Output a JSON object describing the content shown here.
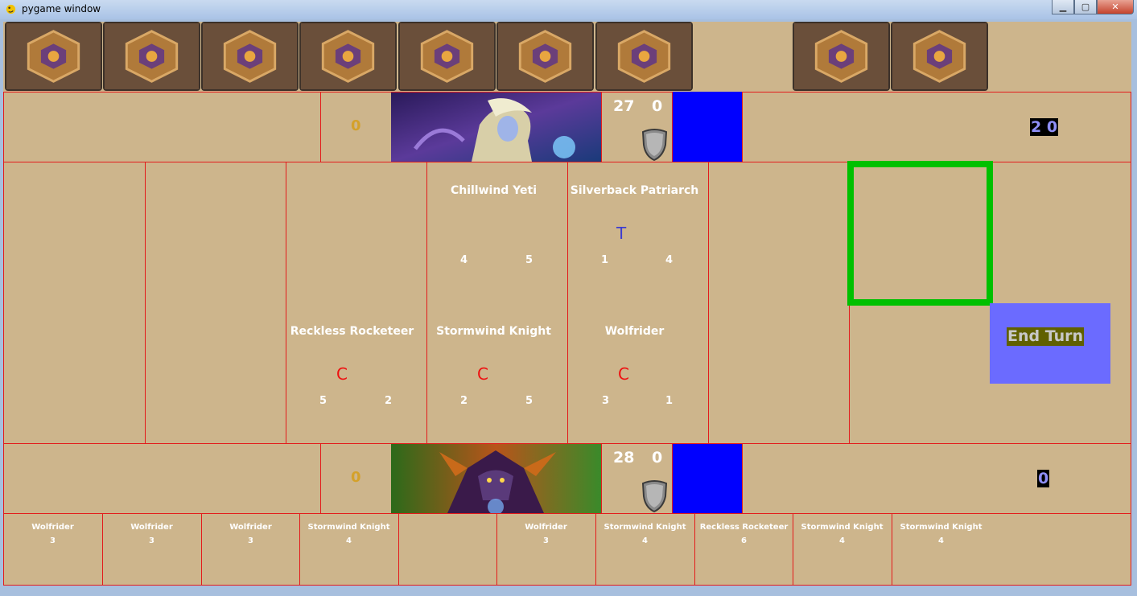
{
  "window": {
    "title": "pygame window"
  },
  "opponent": {
    "hand_count": 7,
    "deck_count": 2,
    "gold": "0",
    "health": "27",
    "armor": "0",
    "counter": "2 0"
  },
  "player": {
    "gold": "0",
    "health": "28",
    "armor": "0",
    "counter": "0"
  },
  "board": {
    "opponent_minions": [
      {
        "name": "Chillwind Yeti",
        "attack": "4",
        "health": "5",
        "tag": ""
      },
      {
        "name": "Silverback Patriarch",
        "attack": "1",
        "health": "4",
        "tag": "T"
      }
    ],
    "player_minions": [
      {
        "name": "Reckless Rocketeer",
        "attack": "5",
        "health": "2",
        "tag": "C"
      },
      {
        "name": "Stormwind Knight",
        "attack": "2",
        "health": "5",
        "tag": "C"
      },
      {
        "name": "Wolfrider",
        "attack": "3",
        "health": "1",
        "tag": "C"
      }
    ]
  },
  "end_turn_label": "End Turn",
  "hand": [
    {
      "name": "Wolfrider",
      "cost": "3"
    },
    {
      "name": "Wolfrider",
      "cost": "3"
    },
    {
      "name": "Wolfrider",
      "cost": "3"
    },
    {
      "name": "Stormwind Knight",
      "cost": "4"
    },
    {
      "name": "",
      "cost": ""
    },
    {
      "name": "Wolfrider",
      "cost": "3"
    },
    {
      "name": "Stormwind Knight",
      "cost": "4"
    },
    {
      "name": "Reckless Rocketeer",
      "cost": "6"
    },
    {
      "name": "Stormwind Knight",
      "cost": "4"
    },
    {
      "name": "Stormwind Knight",
      "cost": "4"
    }
  ],
  "colors": {
    "background": "#cdb58c",
    "grid_line": "#e31b1b",
    "mana_bar": "#0000ff",
    "end_turn_button": "#6b6bff",
    "selection_box": "#00c000"
  }
}
